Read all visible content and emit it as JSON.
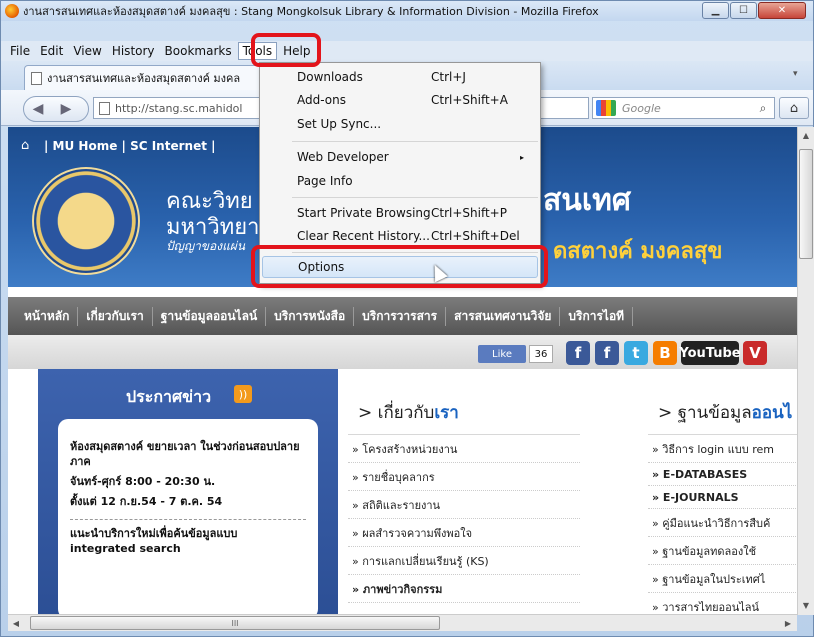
{
  "window": {
    "title": "งานสารสนเทศและห้องสมุดสตางค์ มงคลสุข : Stang Mongkolsuk Library & Information Division - Mozilla Firefox",
    "min_glyph": "▁",
    "max_glyph": "☐",
    "close_glyph": "✕"
  },
  "menubar": [
    "File",
    "Edit",
    "View",
    "History",
    "Bookmarks",
    "Tools",
    "Help"
  ],
  "tab": {
    "title": "งานสารสนเทศและห้องสมุดสตางค์ มงคล",
    "dropdown_glyph": "▾"
  },
  "nav": {
    "back_glyph": "◀",
    "forward_glyph": "▶",
    "url": "http://stang.sc.mahidol",
    "url_dropdown_glyph": "▾",
    "reload_glyph": "C",
    "search_placeholder": "Google",
    "search_glyph": "⌕",
    "home_glyph": "⌂"
  },
  "tools_menu": {
    "items": [
      {
        "label": "Downloads",
        "shortcut": "Ctrl+J"
      },
      {
        "label": "Add-ons",
        "shortcut": "Ctrl+Shift+A"
      },
      {
        "label": "Set Up Sync...",
        "shortcut": ""
      },
      {
        "label": "Web Developer",
        "shortcut": "",
        "submenu": true
      },
      {
        "label": "Page Info",
        "shortcut": ""
      },
      {
        "label": "Start Private Browsing",
        "shortcut": "Ctrl+Shift+P"
      },
      {
        "label": "Clear Recent History...",
        "shortcut": "Ctrl+Shift+Del"
      },
      {
        "label": "Options",
        "shortcut": ""
      }
    ],
    "submenu_glyph": "▸"
  },
  "site": {
    "top_links": "| MU Home | SC Internet |",
    "home_glyph": "⌂",
    "faculty_line1": "คณะวิทย",
    "faculty_line2": "มหาวิทยา",
    "faculty_tagline": "ปัญญาของแผ่น",
    "info_big": "สนเทศ",
    "library_name": "ดสตางค์ มงคลสุข",
    "main_nav": [
      "หน้าหลัก",
      "เกี่ยวกับเรา",
      "ฐานข้อมูลออนไลน์",
      "บริการหนังสือ",
      "บริการวารสาร",
      "สารสนเทศงานวิจัย",
      "บริการไอที"
    ],
    "fb_like": "Like",
    "fb_count": "36",
    "social": {
      "fb": "f",
      "twitter": "t",
      "blogger": "B",
      "youtube": "YouTube",
      "vimeo": "V"
    },
    "news_title": "ประกาศข่าว",
    "rss_glyph": "))",
    "news": [
      "ห้องสมุดสตางค์ ขยายเวลา ในช่วงก่อนสอบปลายภาค",
      "จันทร์-ศุกร์ 8:00 - 20:30 น.",
      "ตั้งแต่ 12 ก.ย.54 - 7 ต.ค. 54",
      "แนะนำบริการใหม่เพื่อค้นข้อมูลแบบ integrated search"
    ],
    "col1": {
      "title_plain": "> เกี่ยวกับ",
      "title_hl": "เรา",
      "items": [
        "» โครงสร้างหน่วยงาน",
        "» รายชื่อบุคลากร",
        "» สถิติและรายงาน",
        "» ผลสำรวจความพึงพอใจ",
        "» การแลกเปลี่ยนเรียนรู้ (KS)",
        "» ภาพข่าวกิจกรรม"
      ]
    },
    "col2": {
      "title_plain": "> ฐานข้อมูล",
      "title_hl": "ออนไ",
      "items": [
        "» วิธีการ login แบบ rem",
        "» E-DATABASES",
        "» E-JOURNALS",
        "» คู่มือแนะนำวิธีการสืบค้",
        "» ฐานข้อมูลทดลองใช้",
        "» ฐานข้อมูลในประเทศไ",
        "» วารสารไทยออนไลน์"
      ]
    }
  },
  "scroll": {
    "up": "▲",
    "down": "▼",
    "left": "◀",
    "right": "▶",
    "grip": "III"
  },
  "colors": {
    "highlight_red": "#e3141b",
    "banner_blue": "#2a63ae",
    "library_gold": "#ffd13b"
  }
}
